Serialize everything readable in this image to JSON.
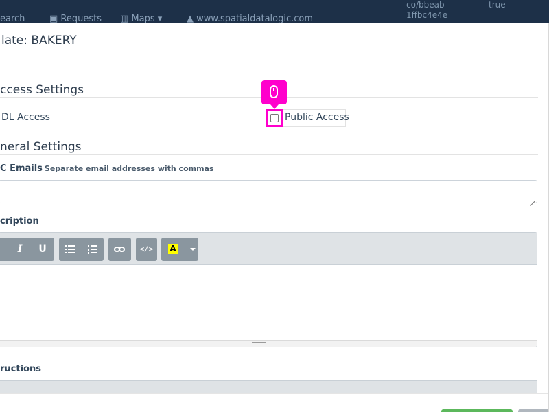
{
  "navbar": {
    "items": [
      "earch",
      "Requests",
      "Maps",
      "www.spatialdatalogic.com"
    ],
    "right": [
      "co/bbeab",
      "true",
      "1ffbc4e4e"
    ]
  },
  "modal": {
    "title": "late: BAKERY",
    "access_section": "ccess Settings",
    "sdl_access_label": "DL Access",
    "public_access_label": "Public Access",
    "public_access_checked": false,
    "general_section": "neral Settings",
    "cc_emails_label": "C Emails",
    "cc_emails_hint": "Separate email addresses with commas",
    "cc_emails_value": "",
    "description_label": "cription",
    "instructions_label": "ructions"
  },
  "editor": {
    "toolbar": {
      "italic": "I",
      "underline": "U",
      "code": "</>",
      "color": "A"
    }
  },
  "colors": {
    "navbar": "#1d3048",
    "highlight": "#ff00cc",
    "toolbar_button": "#8a969f",
    "primary_button": "#5cb85c"
  }
}
